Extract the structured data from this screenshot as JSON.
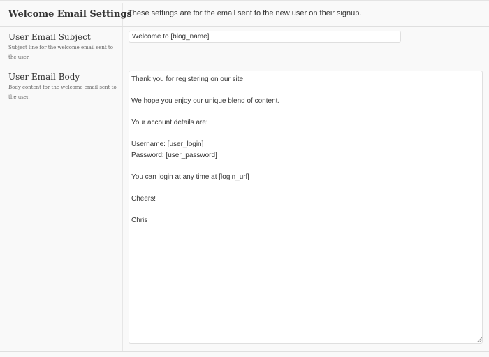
{
  "section": {
    "title": "Welcome Email Settings",
    "description": "These settings are for the email sent to the new user on their signup."
  },
  "subject_field": {
    "label": "User Email Subject",
    "help": "Subject line for the welcome email sent to the user.",
    "value": "Welcome to [blog_name]"
  },
  "body_field": {
    "label": "User Email Body",
    "help": "Body content for the welcome email sent to the user.",
    "value": "Thank you for registering on our site.\n\nWe hope you enjoy our unique blend of content.\n\nYour account details are:\n\nUsername: [user_login]\nPassword: [user_password]\n\nYou can login at any time at [login_url]\n\nCheers!\n\nChris"
  },
  "icons": {
    "resize": "resize-grip-icon"
  }
}
